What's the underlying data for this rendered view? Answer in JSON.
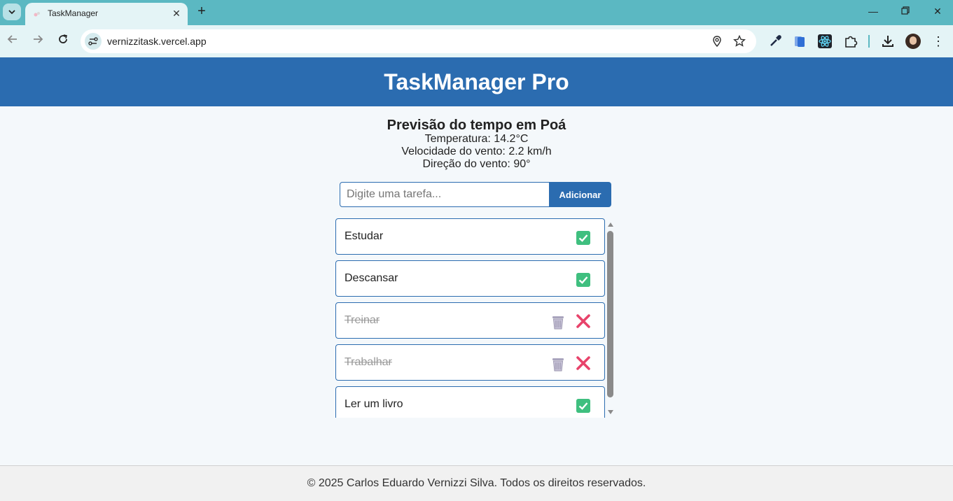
{
  "browser": {
    "tab_title": "TaskManager",
    "url": "vernizzitask.vercel.app"
  },
  "header": {
    "title": "TaskManager Pro"
  },
  "weather": {
    "title": "Previsão do tempo em Poá",
    "temperature": "Temperatura: 14.2°C",
    "wind_speed": "Velocidade do vento: 2.2 km/h",
    "wind_direction": "Direção do vento: 90°"
  },
  "task_form": {
    "placeholder": "Digite uma tarefa...",
    "value": "",
    "add_label": "Adicionar"
  },
  "tasks": [
    {
      "label": "Estudar",
      "completed": false
    },
    {
      "label": "Descansar",
      "completed": false
    },
    {
      "label": "Treinar",
      "completed": true
    },
    {
      "label": "Trabalhar",
      "completed": true
    },
    {
      "label": "Ler um livro",
      "completed": false
    }
  ],
  "footer": {
    "text": "© 2025 Carlos Eduardo Vernizzi Silva. Todos os direitos reservados."
  },
  "colors": {
    "header": "#2b6cb0",
    "check": "#3fbf7f",
    "delete": "#e8436b",
    "tab_strip": "#5bb8c2"
  }
}
